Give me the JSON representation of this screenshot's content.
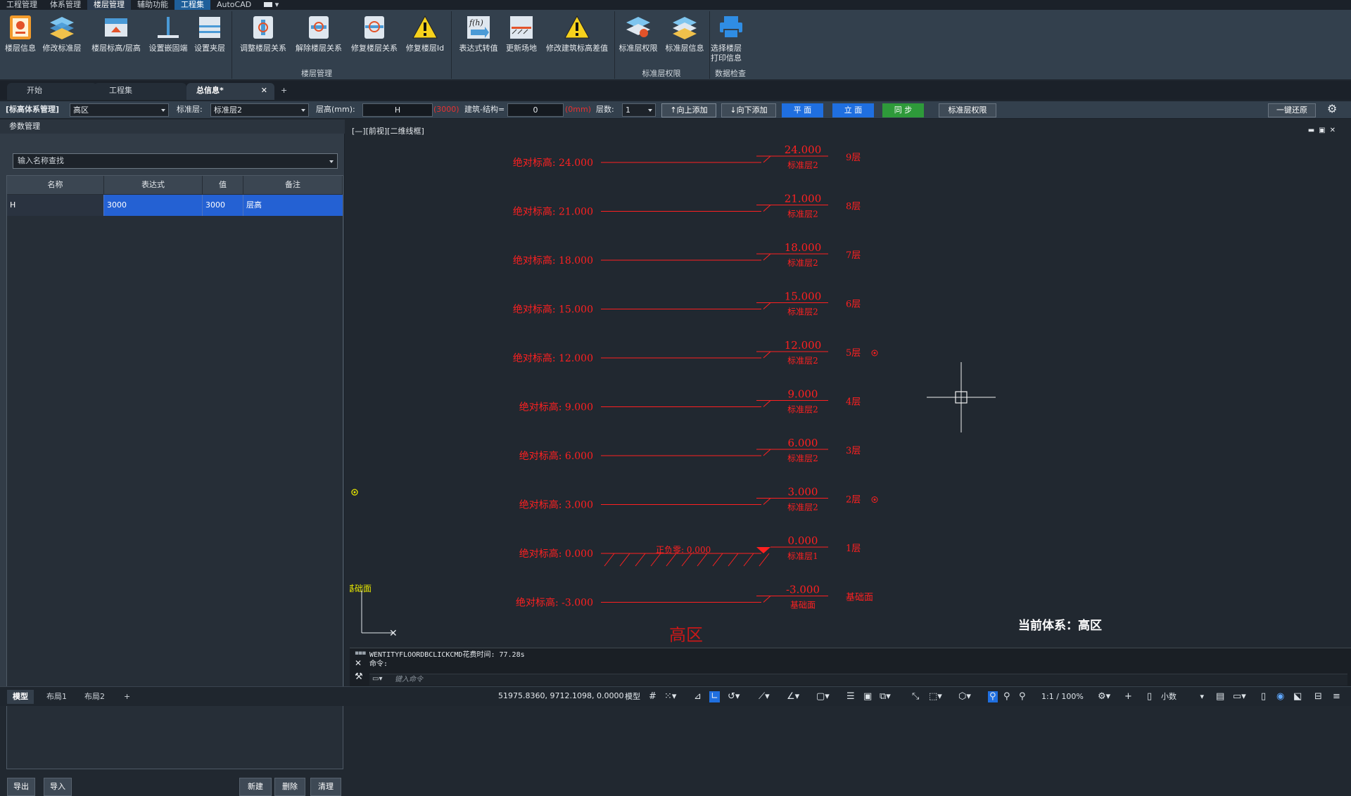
{
  "menu": [
    "工程管理",
    "体系管理",
    "楼层管理",
    "辅助功能",
    "工程集",
    "AutoCAD"
  ],
  "ribbon": {
    "buttons": [
      {
        "label": "楼层信息"
      },
      {
        "label": "修改标准层"
      },
      {
        "label": "楼层标高/层高"
      },
      {
        "label": "设置嵌固端"
      },
      {
        "label": "设置夹层"
      },
      {
        "label": "调整楼层关系"
      },
      {
        "label": "解除楼层关系"
      },
      {
        "label": "修复楼层关系"
      },
      {
        "label": "修复楼层Id"
      },
      {
        "label": "表达式转值"
      },
      {
        "label": "更新场地"
      },
      {
        "label": "修改建筑标高差值"
      },
      {
        "label": "标准层权限"
      },
      {
        "label": "标准层信息"
      },
      {
        "label1": "选择楼层",
        "label2": "打印信息"
      }
    ],
    "groups": [
      "楼层管理",
      "标准层权限",
      "数据检查"
    ]
  },
  "doctabs": [
    {
      "label": "开始"
    },
    {
      "label": "工程集"
    },
    {
      "label": "总信息*"
    }
  ],
  "toolbar": {
    "system_label": "[标高体系管理]",
    "system_value": "高区",
    "std_label": "标准层:",
    "std_value": "标准层2",
    "height_label": "层高(mm):",
    "height_value": "H",
    "height_hint": "(3000)",
    "diff_label": "建筑-结构=",
    "diff_value": "0",
    "diff_hint": "(0mm)",
    "count_label": "层数:",
    "count_value": "1",
    "add_up": "↑向上添加",
    "add_down": "↓向下添加",
    "plan": "平 面",
    "elev": "立 面",
    "sync": "同 步",
    "perm": "标准层权限",
    "restore": "一键还原"
  },
  "param_panel": {
    "title": "参数管理",
    "search_placeholder": "输入名称查找",
    "columns": [
      "名称",
      "表达式",
      "值",
      "备注"
    ],
    "rows": [
      {
        "name": "H",
        "expr": "3000",
        "value": "3000",
        "note": "层高"
      }
    ],
    "buttons": {
      "export": "导出",
      "import": "导入",
      "new": "新建",
      "delete": "删除",
      "clear": "清理"
    }
  },
  "viewport": {
    "label": "[—][前视][二维线框]",
    "system_title": "当前体系：高区",
    "zone_label": "高区",
    "ground_label": "正负零: 0.000",
    "left_tag": "基础面"
  },
  "chart_data": {
    "type": "table",
    "floors": [
      {
        "abs": "绝对标高: 24.000",
        "elev": "24.000",
        "std": "标准层2",
        "floor": "9层"
      },
      {
        "abs": "绝对标高: 21.000",
        "elev": "21.000",
        "std": "标准层2",
        "floor": "8层"
      },
      {
        "abs": "绝对标高: 18.000",
        "elev": "18.000",
        "std": "标准层2",
        "floor": "7层"
      },
      {
        "abs": "绝对标高: 15.000",
        "elev": "15.000",
        "std": "标准层2",
        "floor": "6层"
      },
      {
        "abs": "绝对标高: 12.000",
        "elev": "12.000",
        "std": "标准层2",
        "floor": "5层",
        "mark": true
      },
      {
        "abs": "绝对标高: 9.000",
        "elev": "9.000",
        "std": "标准层2",
        "floor": "4层"
      },
      {
        "abs": "绝对标高: 6.000",
        "elev": "6.000",
        "std": "标准层2",
        "floor": "3层"
      },
      {
        "abs": "绝对标高: 3.000",
        "elev": "3.000",
        "std": "标准层2",
        "floor": "2层",
        "mark": true
      },
      {
        "abs": "绝对标高: 0.000",
        "elev": "0.000",
        "std": "标准层1",
        "floor": "1层",
        "ground": true
      },
      {
        "abs": "绝对标高: -3.000",
        "elev": "-3.000",
        "std": "基础面",
        "floor": "基础面"
      }
    ]
  },
  "command": {
    "log1": "WENTITYFLOORDBCLICKCMD花费时间: 77.28s",
    "log2": "命令:",
    "placeholder": "键入命令"
  },
  "status": {
    "tabs": [
      "模型",
      "布局1",
      "布局2"
    ],
    "coords": "51975.8360, 9712.1098, 0.0000",
    "mode": "模型",
    "scale": "1:1 / 100%",
    "units": "小数"
  },
  "colors": {
    "accent": "#2461d3",
    "cad_red": "#ff2020",
    "green": "#2e9a3a",
    "blue_btn": "#1f6fe0"
  }
}
